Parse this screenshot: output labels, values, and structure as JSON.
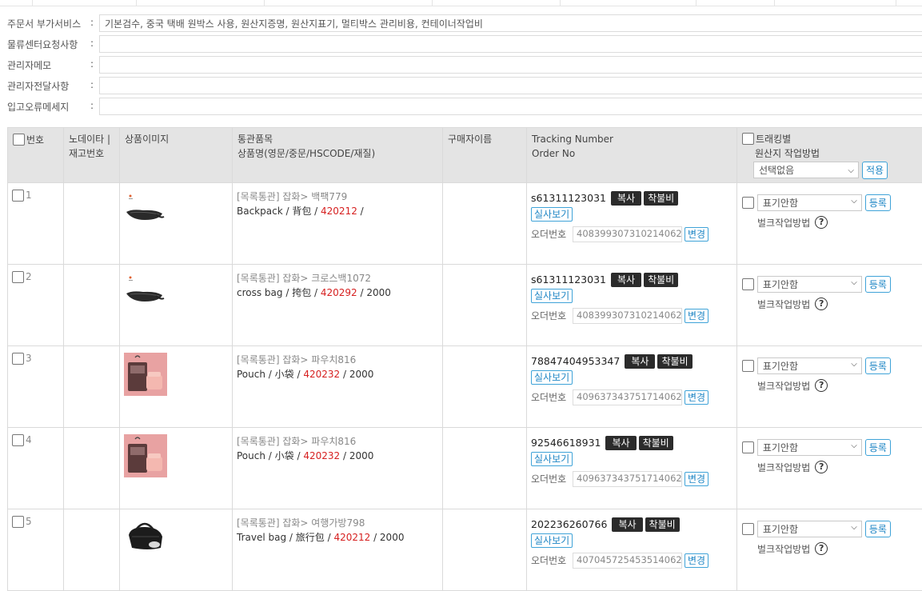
{
  "info_rows": [
    {
      "label": "주문서 부가서비스",
      "value": "기본검수, 중국 택배 원박스 사용, 원산지증명, 원산지표기, 멀티박스 관리비용, 컨테이너작업비"
    },
    {
      "label": "물류센터요청사항",
      "value": ""
    },
    {
      "label": "관리자메모",
      "value": ""
    },
    {
      "label": "관리자전달사항",
      "value": ""
    },
    {
      "label": "입고오류메세지",
      "value": ""
    }
  ],
  "colon": ":",
  "headers": {
    "number": "번호",
    "node_line1": "노데이타 |",
    "node_line2": "재고번호",
    "image": "상품이미지",
    "customs_line1": "통관품목",
    "customs_line2": "상품명(영문/중문/HSCODE/재질)",
    "buyer": "구매자이름",
    "tracking_line1": "Tracking Number",
    "tracking_line2": "Order No",
    "label_line1": "트래킹별",
    "label_line2": "원산지 작업방법",
    "label_select": "선택없음",
    "apply_button": "적용"
  },
  "row_labels": {
    "copy": "복사",
    "arrival_fee": "착불비",
    "view_real": "실사보기",
    "order_no": "오더번호",
    "change": "변경",
    "origin_select": "표기안함",
    "register": "등록",
    "bulk_method": "벌크작업방법",
    "help": "?"
  },
  "rows": [
    {
      "num": "1",
      "category": "[목록통관] 잡화> 백팩779",
      "name_en": "Backpack",
      "name_cn": "背包",
      "hscode": "420212",
      "material": "",
      "tracking": "s61311123031",
      "order_no": "408399307310214062",
      "image": "waist-bag"
    },
    {
      "num": "2",
      "category": "[목록통관] 잡화> 크로스백1072",
      "name_en": "cross bag",
      "name_cn": "挎包",
      "hscode": "420292",
      "material": "2000",
      "tracking": "s61311123031",
      "order_no": "408399307310214062",
      "image": "waist-bag"
    },
    {
      "num": "3",
      "category": "[목록통관] 잡화> 파우치816",
      "name_en": "Pouch",
      "name_cn": "小袋",
      "hscode": "420232",
      "material": "2000",
      "tracking": "78847404953347",
      "order_no": "409637343751714062",
      "image": "pink-pouch"
    },
    {
      "num": "4",
      "category": "[목록통관] 잡화> 파우치816",
      "name_en": "Pouch",
      "name_cn": "小袋",
      "hscode": "420232",
      "material": "2000",
      "tracking": "92546618931",
      "order_no": "409637343751714062",
      "image": "pink-pouch"
    },
    {
      "num": "5",
      "category": "[목록통관] 잡화> 여행가방798",
      "name_en": "Travel bag",
      "name_cn": "旅行包",
      "hscode": "420212",
      "material": "2000",
      "tracking": "202236260766",
      "order_no": "407045725453514062",
      "image": "travel-bag"
    }
  ],
  "colors": {
    "hscode": "#d62020",
    "dark_button": "#2b2b2b",
    "outline_button": "#3fa3d8",
    "header_bg": "#e4e4e4"
  }
}
